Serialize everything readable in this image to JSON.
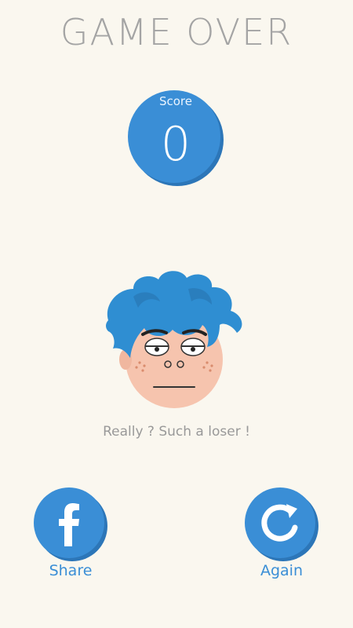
{
  "header": {
    "title": "GAME OVER"
  },
  "score": {
    "label": "Score",
    "value": "0"
  },
  "avatar": {
    "icon": "sad-face-avatar-icon"
  },
  "message": "Really ? Such a loser !",
  "actions": {
    "share": {
      "label": "Share",
      "icon": "facebook-icon"
    },
    "again": {
      "label": "Again",
      "icon": "restart-icon"
    }
  },
  "colors": {
    "background": "#faf7ef",
    "accent": "#3a8ed6",
    "accent_dark": "#2f7cc2",
    "title": "#a4a4a4",
    "hair": "#2f8ed2",
    "skin": "#f6c4ae"
  }
}
